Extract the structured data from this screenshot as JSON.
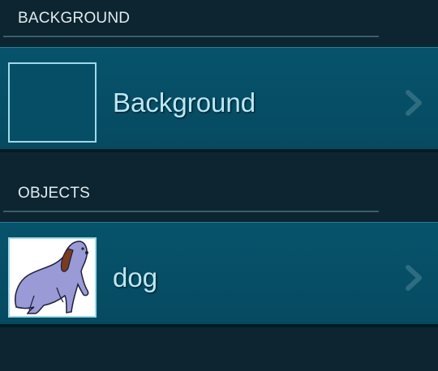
{
  "sections": {
    "background": {
      "header": "BACKGROUND",
      "item_label": "Background"
    },
    "objects": {
      "header": "OBJECTS",
      "item_label": "dog"
    }
  },
  "icons": {
    "chevron": "chevron-right-icon",
    "dog": "dog-sprite-thumbnail"
  },
  "colors": {
    "page_bg": "#0c2530",
    "row_bg": "#07536c",
    "label_text": "#b8e9f6",
    "thumb_border": "#9fd9ea",
    "dog_body": "#9a9ad6",
    "dog_ear": "#7a3b1f"
  }
}
